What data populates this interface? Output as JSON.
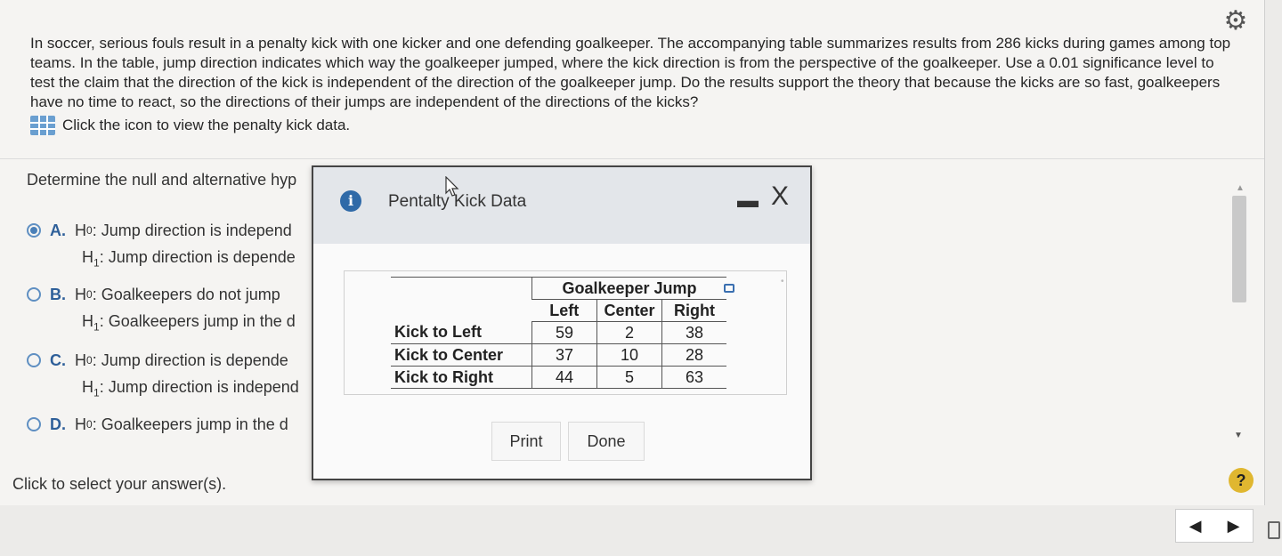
{
  "question": {
    "text": "In soccer, serious fouls result in a penalty kick with one kicker and one defending goalkeeper. The accompanying table summarizes results from 286 kicks during games among top teams. In the table, jump direction indicates which way the goalkeeper jumped, where the kick direction is from the perspective of the goalkeeper. Use a 0.01 significance level to test the claim that the direction of the kick is independent of the direction of the goalkeeper jump. Do the results support the theory that because the kicks are so fast, goalkeepers have no time to react, so the directions of their jumps are independent of the directions of the kicks?",
    "data_link": "Click the icon to view the penalty kick data."
  },
  "prompt": "Determine the null and alternative hyp",
  "options": [
    {
      "letter": "A.",
      "h0_label": "H",
      "h0_sub": "0",
      "h0": ": Jump direction is independ",
      "h1_label": "H",
      "h1_sub": "1",
      "h1": ": Jump direction is depende",
      "selected": true
    },
    {
      "letter": "B.",
      "h0_label": "H",
      "h0_sub": "0",
      "h0": ": Goalkeepers do not jump",
      "h1_label": "H",
      "h1_sub": "1",
      "h1": ": Goalkeepers jump in the d",
      "selected": false
    },
    {
      "letter": "C.",
      "h0_label": "H",
      "h0_sub": "0",
      "h0": ": Jump direction is depende",
      "h1_label": "H",
      "h1_sub": "1",
      "h1": ": Jump direction is independ",
      "selected": false
    },
    {
      "letter": "D.",
      "h0_label": "H",
      "h0_sub": "0",
      "h0": ": Goalkeepers jump in the d",
      "selected": false
    }
  ],
  "footer": {
    "click_select": "Click to select your answer(s).",
    "help": "?"
  },
  "nav": {
    "prev": "◀",
    "next": "▶"
  },
  "icons": {
    "gear": "gear-icon",
    "info": "info-icon"
  },
  "colors": {
    "accent": "#2f6aa8",
    "help": "#e0b730"
  },
  "dialog": {
    "title": "Pentalty Kick Data",
    "minimize": "▬",
    "close": "X",
    "table": {
      "group_header": "Goalkeeper Jump",
      "columns": [
        "Left",
        "Center",
        "Right"
      ],
      "rows": [
        {
          "label": "Kick to Left",
          "values": [
            "59",
            "2",
            "38"
          ]
        },
        {
          "label": "Kick to Center",
          "values": [
            "37",
            "10",
            "28"
          ]
        },
        {
          "label": "Kick to Right",
          "values": [
            "44",
            "5",
            "63"
          ]
        }
      ]
    },
    "print_label": "Print",
    "done_label": "Done"
  }
}
